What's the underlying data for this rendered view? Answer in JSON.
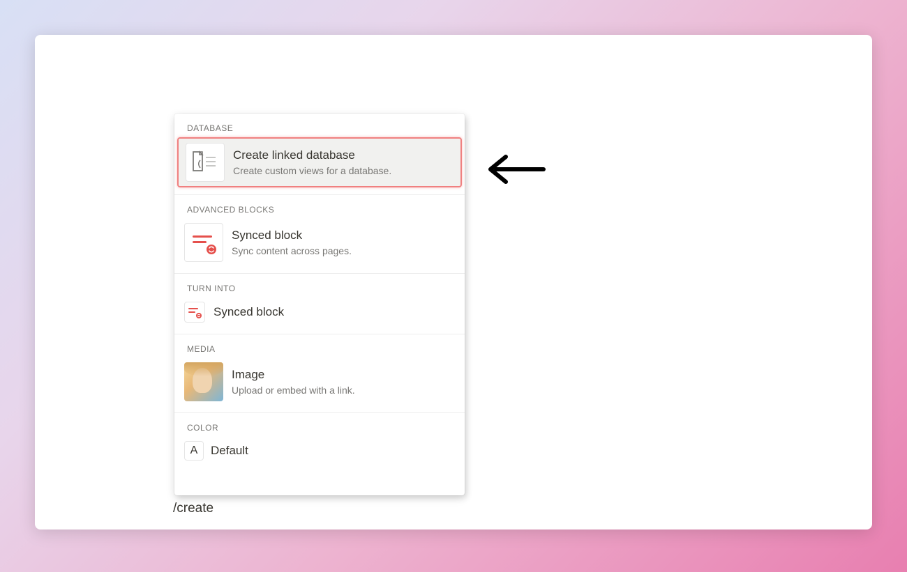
{
  "slash_command": "/create",
  "menu": {
    "sections": [
      {
        "header": "DATABASE",
        "items": [
          {
            "title": "Create linked database",
            "desc": "Create custom views for a database.",
            "selected": true,
            "icon": "linked-database-icon"
          }
        ]
      },
      {
        "header": "ADVANCED BLOCKS",
        "items": [
          {
            "title": "Synced block",
            "desc": "Sync content across pages.",
            "icon": "synced-block-icon"
          }
        ]
      },
      {
        "header": "TURN INTO",
        "items": [
          {
            "title": "Synced block",
            "icon": "synced-block-small-icon"
          }
        ]
      },
      {
        "header": "MEDIA",
        "items": [
          {
            "title": "Image",
            "desc": "Upload or embed with a link.",
            "icon": "image-thumbnail"
          }
        ]
      },
      {
        "header": "COLOR",
        "items": [
          {
            "title": "Default",
            "icon": "color-default"
          }
        ]
      }
    ]
  }
}
